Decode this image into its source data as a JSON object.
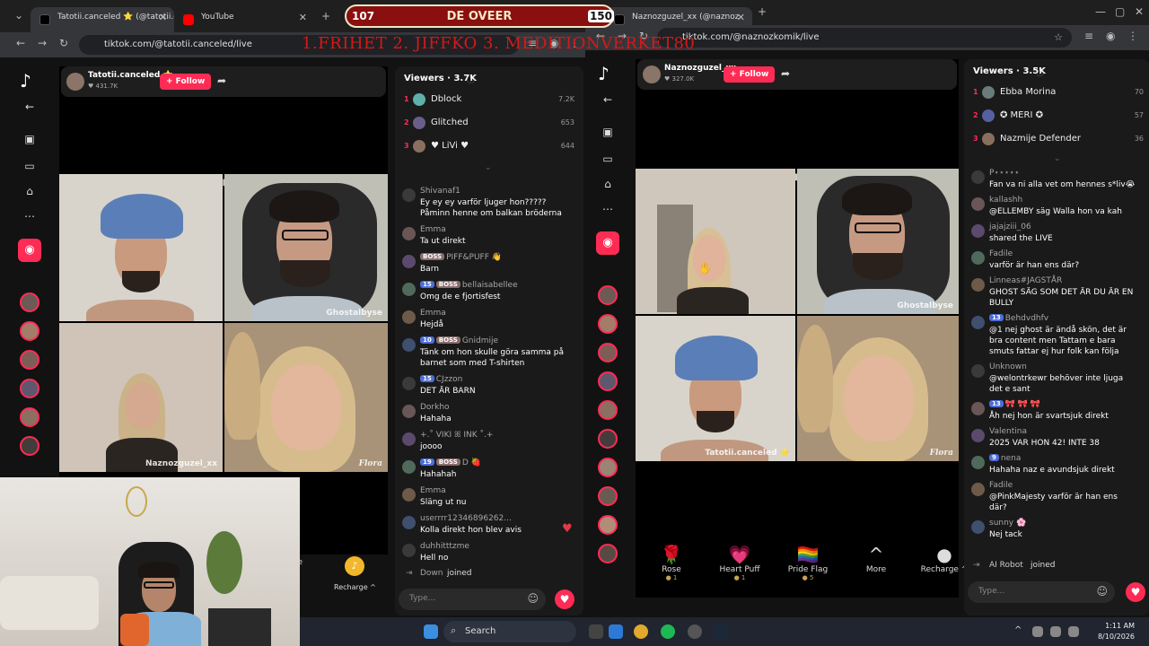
{
  "overlay": {
    "left_number": "107",
    "title": "DE OVEER",
    "right_number": "150",
    "subtitle": "1.FRIHET  2. JIFFKO  3. MEDITIONVERKET80"
  },
  "left_window": {
    "tabs": [
      {
        "label": "Tatotii.canceled ⭐ (@tatotii.ca"
      },
      {
        "label": "YouTube"
      }
    ],
    "url": "tiktok.com/@tatotii.canceled/live",
    "host": {
      "name": "Tatotii.canceled ⭐",
      "likes": "♥ 431.7K",
      "follow": "+ Follow"
    },
    "tile_labels": [
      "Ghostalbyse",
      "Naznozguzel_xx",
      "Flora"
    ],
    "viewers": {
      "title": "Viewers · 3.7K",
      "list": [
        {
          "rank": "1",
          "name": "Dblock",
          "value": "7.2K"
        },
        {
          "rank": "2",
          "name": "Glitched",
          "value": "653"
        },
        {
          "rank": "3",
          "name": "♥ LiVi ♥",
          "value": "644"
        }
      ]
    },
    "messages": [
      {
        "name": "Shivanaf1",
        "badges": [],
        "text": "Ey ey ey varför ljuger hon?????\nPåminn henne om balkan bröderna"
      },
      {
        "name": "Emma",
        "badges": [],
        "text": "Ta ut direkt"
      },
      {
        "name": "PIFF&PUFF 👋",
        "badges": [
          "BOSS"
        ],
        "text": "Barn"
      },
      {
        "name": "bellaisabellee",
        "badges": [
          "15",
          "BOSS"
        ],
        "text": "Omg de e fjortisfest"
      },
      {
        "name": "Emma",
        "badges": [],
        "text": "Hejdå"
      },
      {
        "name": "Gnidmije",
        "badges": [
          "10",
          "BOSS"
        ],
        "text": "Tänk om hon skulle göra samma på\nbarnet som med T-shirten"
      },
      {
        "name": "CJzzon",
        "badges": [
          "15"
        ],
        "text": "DET ÄR BARN"
      },
      {
        "name": "Dorkho",
        "badges": [],
        "text": "Hahaha"
      },
      {
        "name": "+.˚ VIKI ꕤ INK ˚.+",
        "badges": [],
        "text": "joooo"
      },
      {
        "name": "D 🍓",
        "badges": [
          "19",
          "BOSS"
        ],
        "text": "Hahahah"
      },
      {
        "name": "Emma",
        "badges": [],
        "text": "Släng ut nu"
      },
      {
        "name": "userrrr12346896262...",
        "badges": [],
        "text": "Kolla direkt hon blev avis"
      },
      {
        "name": "duhhitttzme",
        "badges": [],
        "text": "Hell no"
      }
    ],
    "joined": {
      "name": "Down",
      "text": "joined"
    },
    "type_placeholder": "Type...",
    "bottom": {
      "partial": "re",
      "recharge": "Recharge ^"
    }
  },
  "right_window": {
    "tabs": [
      {
        "label": "Naznozguzel_xx (@naznoz"
      }
    ],
    "url": "tiktok.com/@naznozkomik/live",
    "host": {
      "name": "Naznozguzel_xx",
      "likes": "♥ 327.0K",
      "follow": "+ Follow"
    },
    "tile_labels": [
      "Ghostalbyse",
      "Tatotii.canceled ⭐",
      "Flora"
    ],
    "viewers": {
      "title": "Viewers · 3.5K",
      "list": [
        {
          "rank": "1",
          "name": "Ebba Morina",
          "value": "70"
        },
        {
          "rank": "2",
          "name": "✪ MERI ✪",
          "value": "57"
        },
        {
          "rank": "3",
          "name": "Nazmije Defender",
          "value": "36"
        }
      ]
    },
    "messages": [
      {
        "name": "P⋆⋆⋆⋆⋆",
        "badges": [],
        "text": "Fan va ni alla vet om hennes s*liv😭"
      },
      {
        "name": "kallashh",
        "badges": [],
        "text": "@ELLEMBY säg Walla hon va kah"
      },
      {
        "name": "jajajziii_06",
        "badges": [],
        "text": "shared the LIVE"
      },
      {
        "name": "Fadile",
        "badges": [],
        "text": "varför är han ens där?"
      },
      {
        "name": "Linneas#JAGSTÅR",
        "badges": [],
        "text": "GHOST SÄG SOM DET ÄR DU ÄR EN\nBULLY"
      },
      {
        "name": "Behdvdhfv",
        "badges": [
          "13"
        ],
        "text": "@1 nej ghost är ändå skön, det är\nbra content men Tattam e bara\nsmuts fattar ej hur folk kan följa"
      },
      {
        "name": "Unknown",
        "badges": [],
        "text": "@welontrkewr behöver inte ljuga\ndet e sant"
      },
      {
        "name": "🎀 🎀 🎀",
        "badges": [
          "13"
        ],
        "text": "Åh nej hon är svartsjuk direkt"
      },
      {
        "name": "Valentina",
        "badges": [],
        "text": "2025 VAR HON 42! INTE 38"
      },
      {
        "name": "nena",
        "badges": [
          "9"
        ],
        "text": "Hahaha naz e avundsjuk direkt"
      },
      {
        "name": "Fadile",
        "badges": [],
        "text": "@PinkMajesty varför är han ens\ndär?"
      },
      {
        "name": "sunny 🌸",
        "badges": [],
        "text": "Nej tack"
      }
    ],
    "joined": {
      "name": "AI Robot",
      "text": "joined"
    },
    "type_placeholder": "Type...",
    "gifts": [
      {
        "name": "Rose",
        "price": "● 1",
        "icon": "🌹"
      },
      {
        "name": "Heart Puff",
        "price": "● 1",
        "icon": "💗"
      },
      {
        "name": "Pride Flag",
        "price": "● 5",
        "icon": "🏳️‍🌈"
      },
      {
        "name": "More",
        "price": "",
        "icon": "^"
      },
      {
        "name": "Recharge ^",
        "price": "",
        "icon": "●"
      }
    ]
  },
  "taskbar": {
    "search": "Search",
    "time": "1:11 AM",
    "date": "8/10/2026"
  }
}
